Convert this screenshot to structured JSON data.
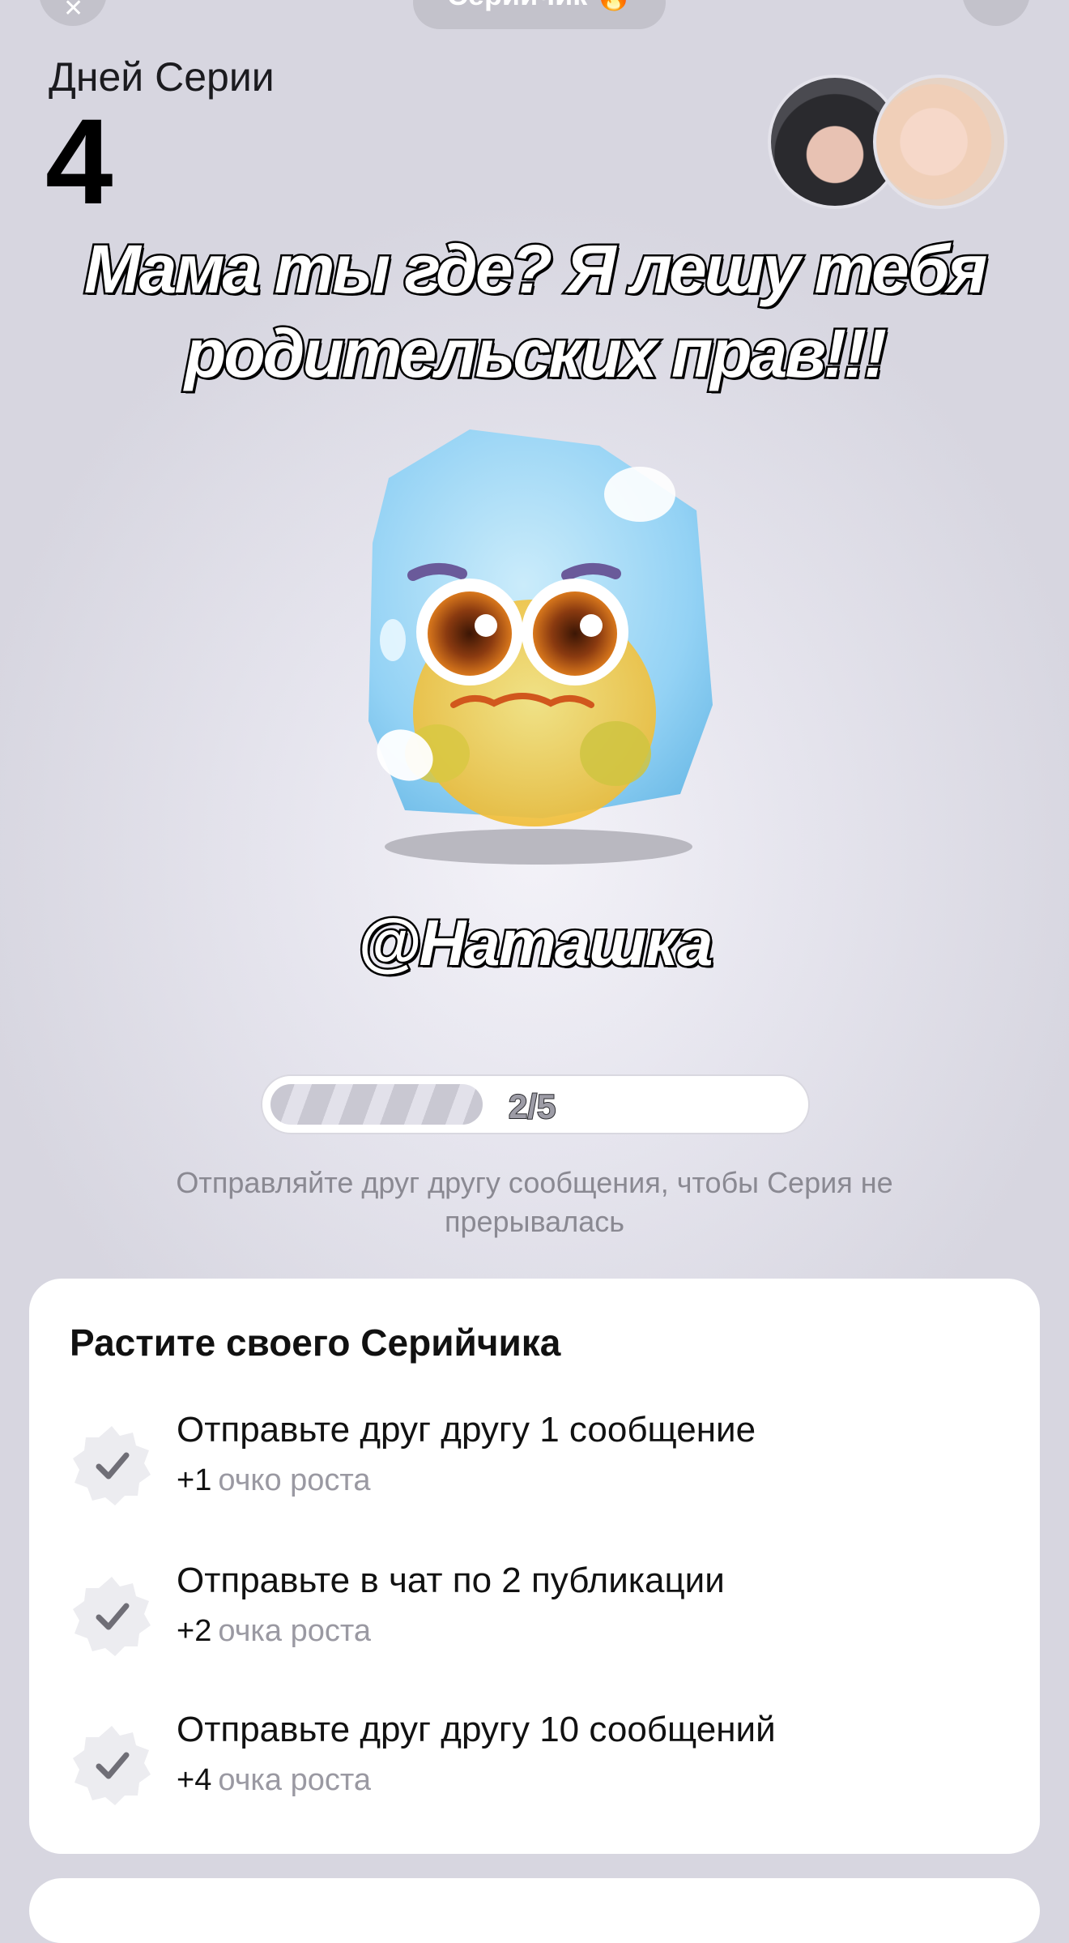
{
  "header": {
    "title": "Серийчик 🔥",
    "close_symbol": "✕"
  },
  "streak": {
    "label": "Дней Серии",
    "count": "4"
  },
  "caption": {
    "line1": "Мама ты где? Я лешу тебя",
    "line2": "родительских прав!!!"
  },
  "mention": "@Наташка",
  "progress": {
    "text": "2/5",
    "fraction": 0.4
  },
  "hint": "Отправляйте друг другу сообщения, чтобы Серия не прерывалась",
  "growth_card": {
    "title": "Растите своего Серийчика",
    "tasks": [
      {
        "title": "Отправьте друг другу 1 сообщение",
        "points": "+1",
        "unit": "очко роста"
      },
      {
        "title": "Отправьте в чат по 2 публикации",
        "points": "+2",
        "unit": "очка роста"
      },
      {
        "title": "Отправьте друг другу 10 сообщений",
        "points": "+4",
        "unit": "очка роста"
      }
    ]
  },
  "colors": {
    "accent_ice": "#8fd1f5",
    "mascot_yellow": "#f4c23a",
    "muted_text": "#8a8992"
  }
}
